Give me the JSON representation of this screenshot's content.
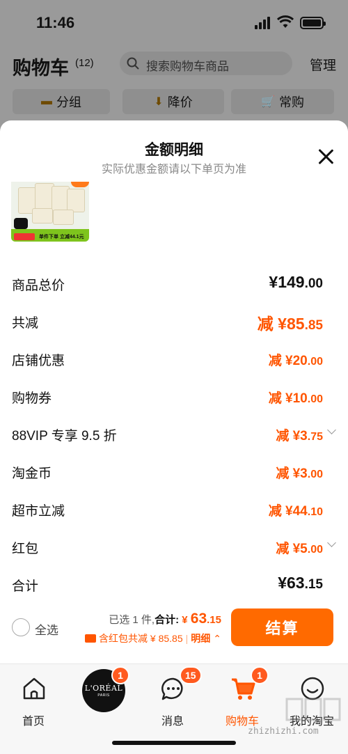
{
  "status_bar": {
    "time": "11:46"
  },
  "header": {
    "title": "购物车",
    "count": "(12)",
    "search_placeholder": "搜索购物车商品",
    "manage": "管理"
  },
  "filters": [
    {
      "label": "分组",
      "icon": "folder-icon"
    },
    {
      "label": "降价",
      "icon": "price-drop-icon"
    },
    {
      "label": "常购",
      "icon": "cart-icon"
    }
  ],
  "sheet": {
    "title": "金额明细",
    "subtitle": "实际优惠金额请以下单页为准",
    "product_thumb_text": "单件下单 立减44.1元",
    "rows": [
      {
        "label": "商品总价",
        "prefix": "¥",
        "int": "149",
        "dec": ".00",
        "style": "total"
      },
      {
        "label": "共减",
        "prefix": "减 ¥",
        "int": "85",
        "dec": ".85",
        "style": "big-red"
      },
      {
        "label": "店铺优惠",
        "prefix": "减 ¥",
        "int": "20",
        "dec": ".00",
        "style": "red"
      },
      {
        "label": "购物券",
        "prefix": "减 ¥",
        "int": "10",
        "dec": ".00",
        "style": "red"
      },
      {
        "label": "88VIP 专享 9.5 折",
        "prefix": "减 ¥",
        "int": "3",
        "dec": ".75",
        "style": "red",
        "chevron": true
      },
      {
        "label": "淘金币",
        "prefix": "减 ¥",
        "int": "3",
        "dec": ".00",
        "style": "red"
      },
      {
        "label": "超市立减",
        "prefix": "减 ¥",
        "int": "44",
        "dec": ".10",
        "style": "red"
      },
      {
        "label": "红包",
        "prefix": "减 ¥",
        "int": "5",
        "dec": ".00",
        "style": "red",
        "chevron": true
      },
      {
        "label": "合计",
        "prefix": "¥",
        "int": "63",
        "dec": ".15",
        "style": "total"
      }
    ]
  },
  "checkout": {
    "select_all": "全选",
    "selected_text": "已选 1 件,",
    "total_label": "合计:",
    "total_prefix": "¥ ",
    "total_int": "63",
    "total_dec": ".15",
    "discount_text": "含红包共减 ¥ 85.85",
    "detail_text": "明细",
    "pay_button": "结算"
  },
  "tabbar": {
    "tabs": [
      {
        "label": "首页",
        "icon": "home-icon"
      },
      {
        "label": "",
        "icon": "loreal-brand-icon",
        "badge": "1",
        "brand_name": "L'ORÉAL",
        "brand_sub": "PARIS"
      },
      {
        "label": "消息",
        "icon": "message-icon",
        "badge": "15"
      },
      {
        "label": "购物车",
        "icon": "cart-icon",
        "badge": "1",
        "active": true
      },
      {
        "label": "我的淘宝",
        "icon": "profile-icon"
      }
    ]
  },
  "watermark": "zhizhizhi.com",
  "colors": {
    "accent": "#ff5500",
    "button": "#ff6a00"
  }
}
